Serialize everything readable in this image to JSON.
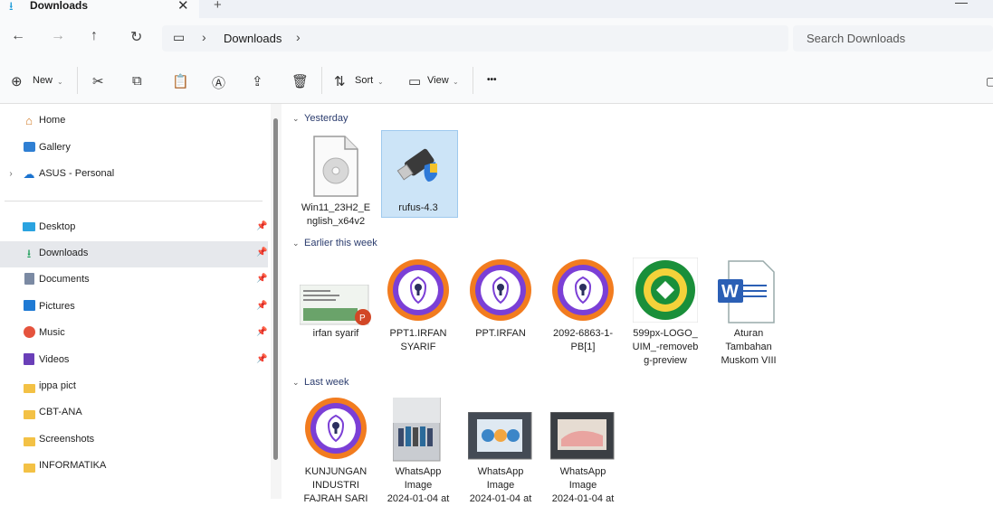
{
  "window": {
    "tab_title": "Downloads",
    "tab_close": "✕",
    "new_tab": "+",
    "minimize": "—"
  },
  "nav": {
    "back": "←",
    "forward": "→",
    "up": "↑",
    "refresh": "↻",
    "breadcrumb": "Downloads",
    "chevron": "›",
    "search_placeholder": "Search Downloads"
  },
  "toolbar": {
    "new_label": "New",
    "sort_label": "Sort",
    "view_label": "View",
    "more": "•••"
  },
  "sidebar": {
    "top": [
      {
        "label": "Home",
        "icon": "home-icon"
      },
      {
        "label": "Gallery",
        "icon": "gallery-icon"
      },
      {
        "label": "ASUS - Personal",
        "icon": "cloud-icon"
      }
    ],
    "pinned": [
      {
        "label": "Desktop",
        "icon": "desktop-icon"
      },
      {
        "label": "Downloads",
        "icon": "download-icon",
        "selected": true
      },
      {
        "label": "Documents",
        "icon": "documents-icon"
      },
      {
        "label": "Pictures",
        "icon": "pictures-icon"
      },
      {
        "label": "Music",
        "icon": "music-icon"
      },
      {
        "label": "Videos",
        "icon": "videos-icon"
      }
    ],
    "folders": [
      {
        "label": "ippa pict"
      },
      {
        "label": "CBT-ANA"
      },
      {
        "label": "Screenshots"
      },
      {
        "label": "INFORMATIKA"
      }
    ]
  },
  "groups": [
    {
      "title": "Yesterday",
      "files": [
        {
          "name": "Win11_23H2_E\nnglish_x64v2",
          "icon": "disc-image-icon"
        },
        {
          "name": "rufus-4.3",
          "icon": "usb-drive-icon",
          "selected": true
        }
      ]
    },
    {
      "title": "Earlier this week",
      "files": [
        {
          "name": "irfan syarif",
          "icon": "powerpoint-thumbnail-icon"
        },
        {
          "name": "PPT1.IRFAN\nSYARIF",
          "icon": "avast-browser-icon"
        },
        {
          "name": "PPT.IRFAN",
          "icon": "avast-browser-icon"
        },
        {
          "name": "2092-6863-1-\nPB[1]",
          "icon": "avast-browser-icon"
        },
        {
          "name": "599px-LOGO_\nUIM_-removeb\ng-preview",
          "icon": "uim-logo-icon"
        },
        {
          "name": "Aturan\nTambahan\nMuskom VIII",
          "icon": "word-document-icon"
        }
      ]
    },
    {
      "title": "Last week",
      "files": [
        {
          "name": "KUNJUNGAN\nINDUSTRI\nFAJRAH SARI",
          "icon": "avast-browser-icon"
        },
        {
          "name": "WhatsApp\nImage\n2024-01-04 at",
          "icon": "photo-group-icon"
        },
        {
          "name": "WhatsApp\nImage\n2024-01-04 at",
          "icon": "photo-presentation-icon"
        },
        {
          "name": "WhatsApp\nImage\n2024-01-04 at",
          "icon": "photo-screen-icon"
        }
      ]
    }
  ]
}
